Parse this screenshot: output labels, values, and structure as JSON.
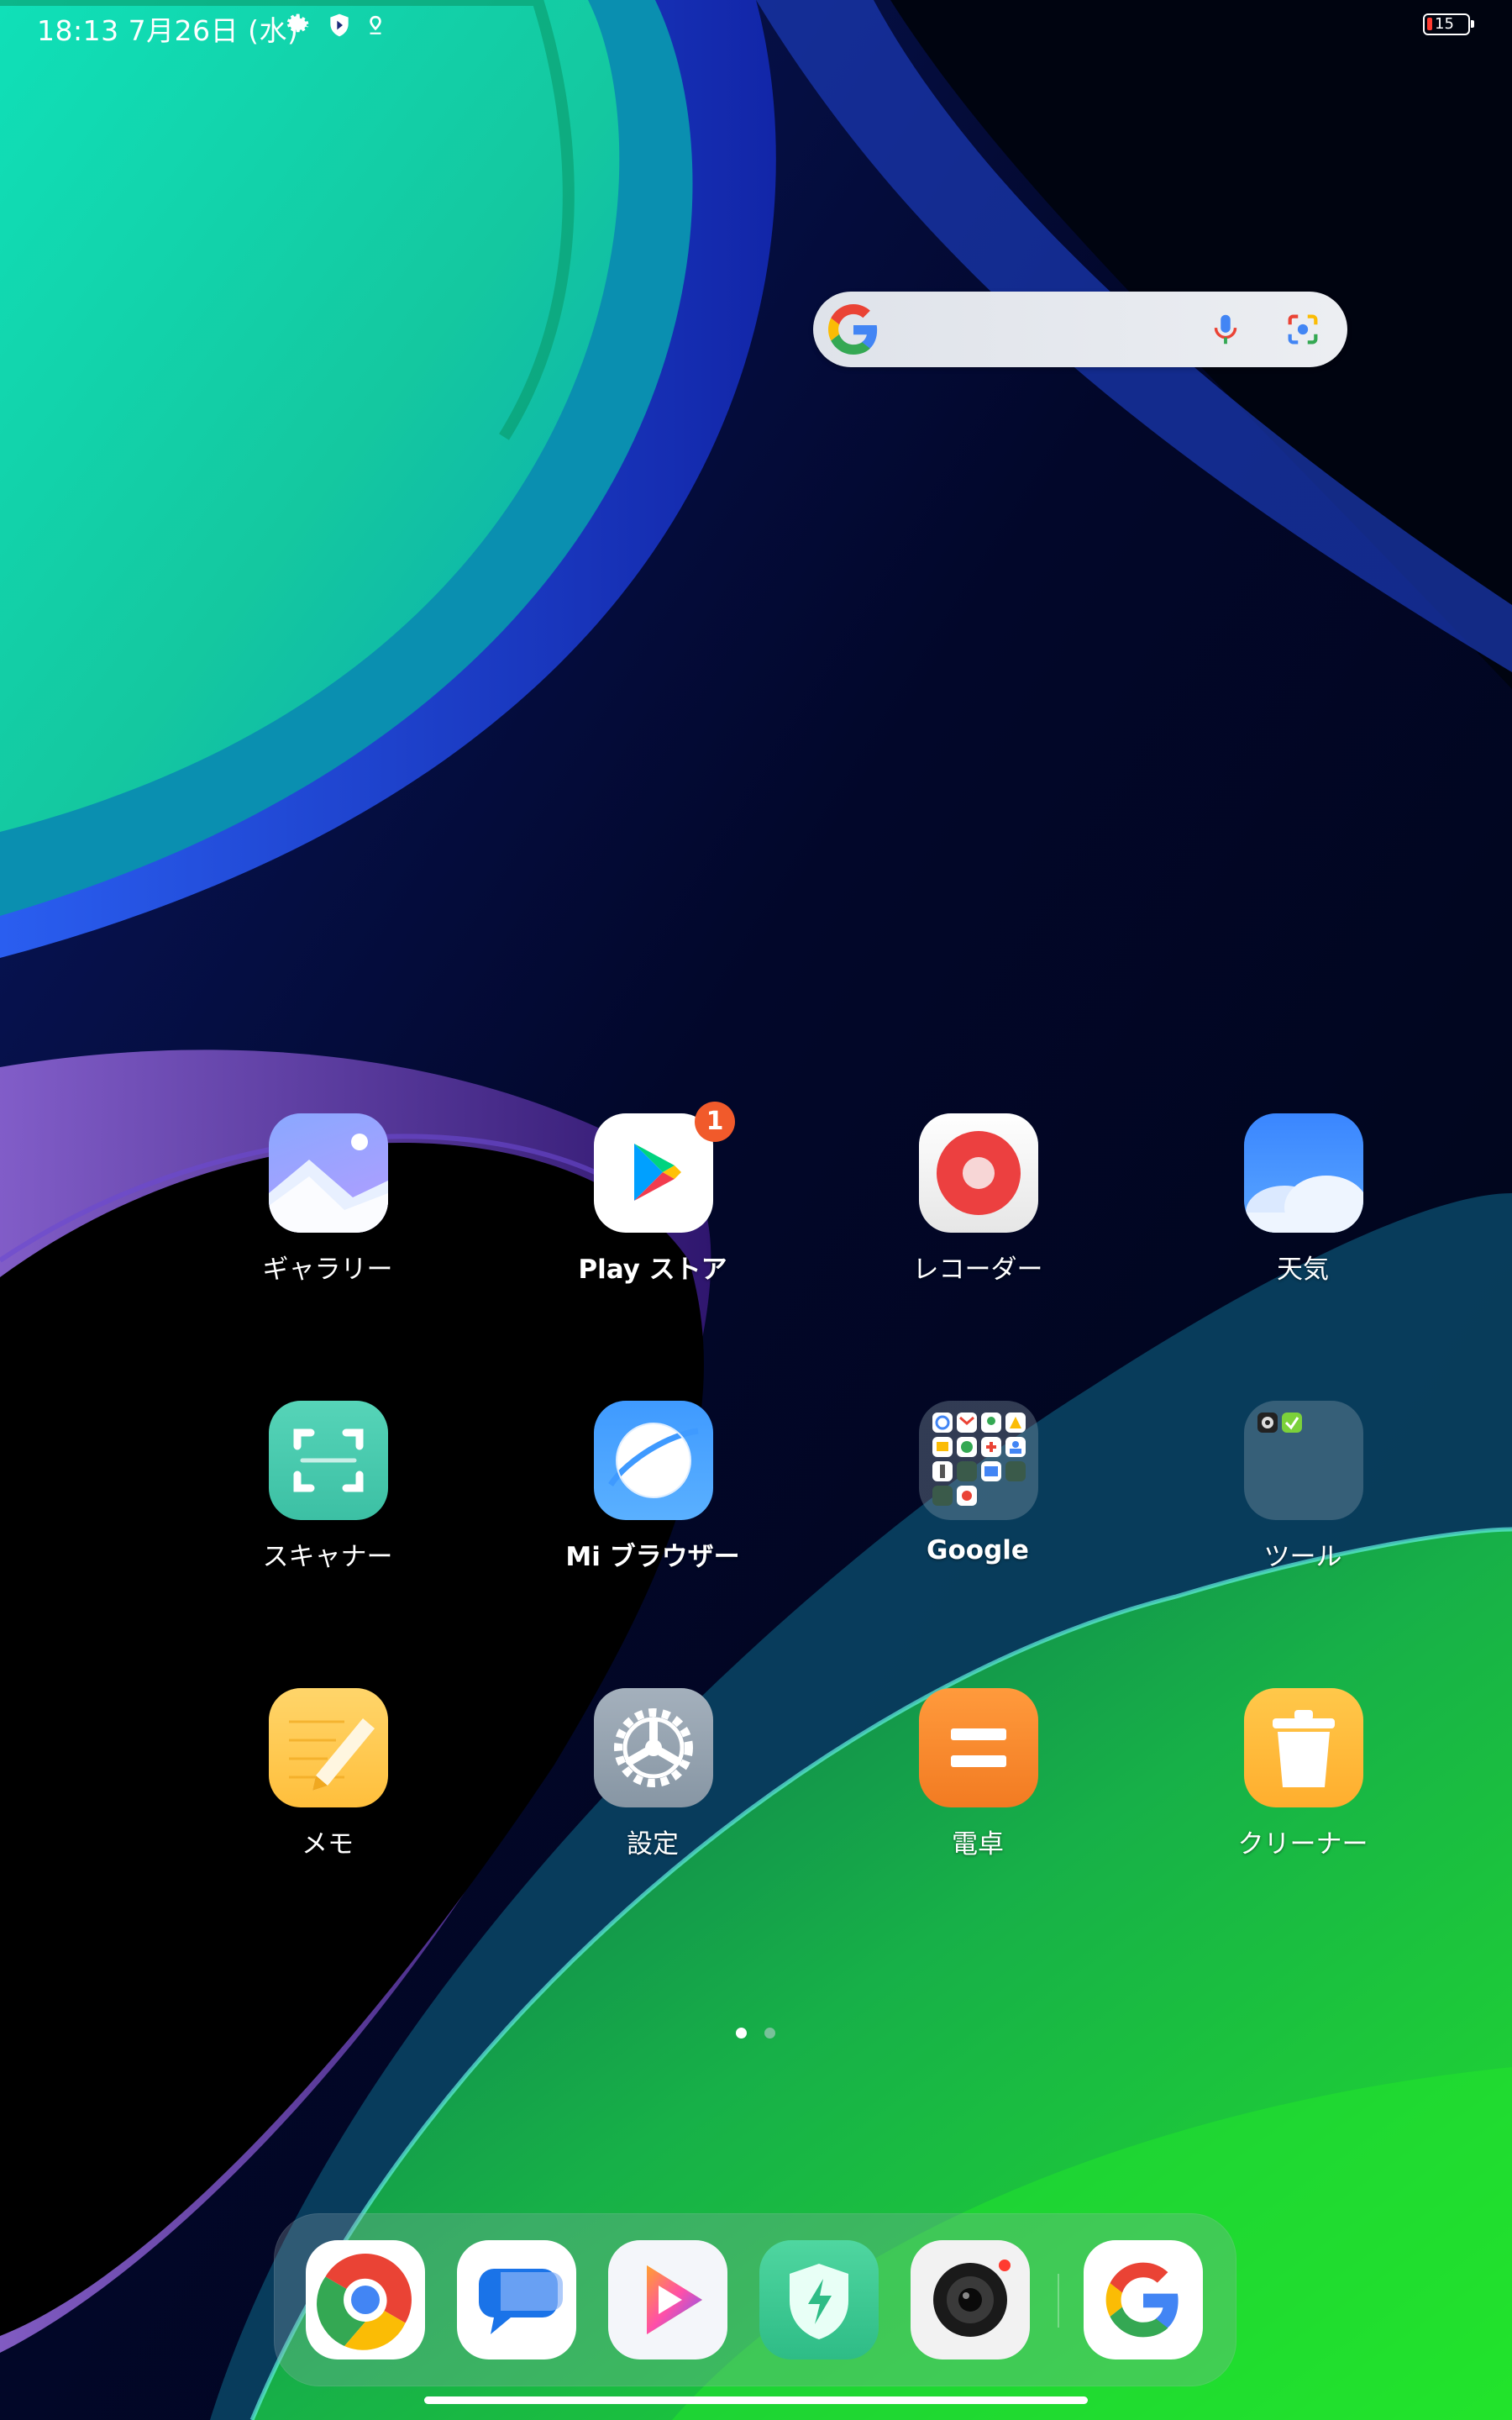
{
  "status_bar": {
    "time_date": "18:13 7月26日 (水)",
    "battery_level": "15",
    "icons": [
      "gear-icon",
      "shield-icon",
      "location-icon"
    ]
  },
  "search_widget": {
    "icons": [
      "google-g-icon",
      "microphone-icon",
      "google-lens-icon"
    ]
  },
  "apps": [
    {
      "label": "ギャラリー",
      "icon": "gallery-icon"
    },
    {
      "label": "Play ストア",
      "icon": "play-store-icon",
      "badge": "1"
    },
    {
      "label": "レコーダー",
      "icon": "recorder-icon"
    },
    {
      "label": "天気",
      "icon": "weather-icon"
    },
    {
      "label": "スキャナー",
      "icon": "scanner-icon"
    },
    {
      "label": "Mi ブラウザー",
      "icon": "browser-icon"
    },
    {
      "label": "Google",
      "icon": "folder-icon"
    },
    {
      "label": "ツール",
      "icon": "folder-icon"
    },
    {
      "label": "メモ",
      "icon": "notes-icon"
    },
    {
      "label": "設定",
      "icon": "settings-gear-icon"
    },
    {
      "label": "電卓",
      "icon": "calculator-icon"
    },
    {
      "label": "クリーナー",
      "icon": "cleaner-icon"
    }
  ],
  "page_indicator": {
    "current_page": 1,
    "total_pages": 2
  },
  "dock": {
    "icons": [
      "chrome-icon",
      "messages-icon",
      "video-player-icon",
      "security-icon",
      "camera-icon",
      "google-icon"
    ]
  },
  "colors": {
    "badge": "#f15a2b",
    "wallpaper_teal": "#12d8b0",
    "wallpaper_blue": "#1a3dd6",
    "wallpaper_green": "#1ed33a"
  }
}
